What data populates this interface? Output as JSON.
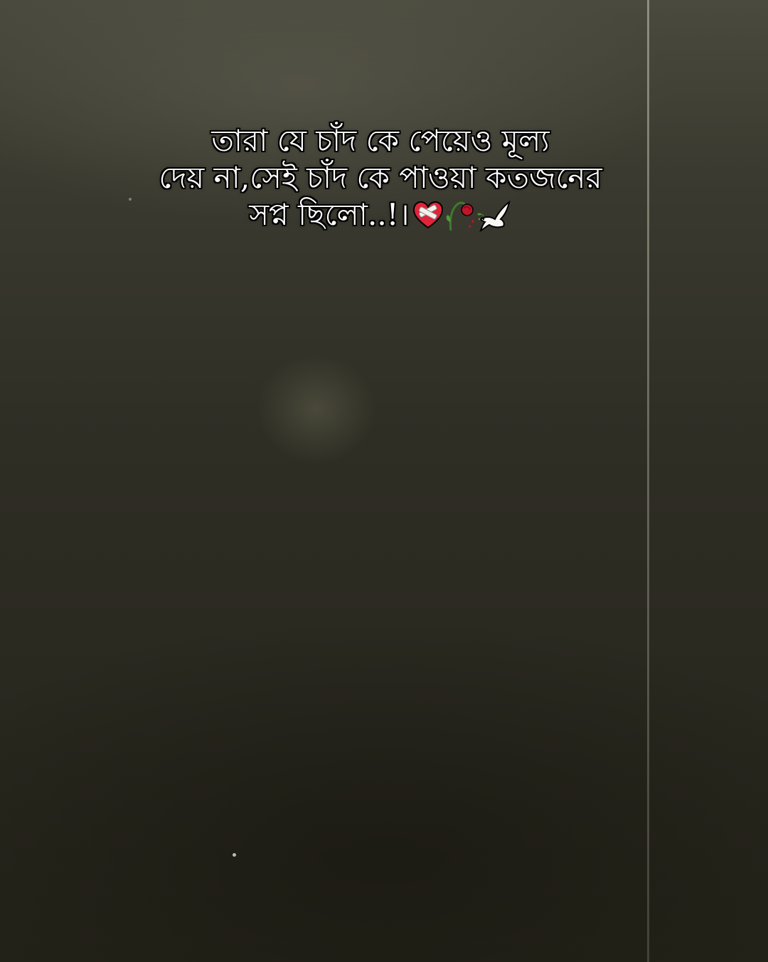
{
  "caption": {
    "line1": "তারা যে চাঁদ কে পেয়েও মূল্য",
    "line2": "দেয় না,সেই চাঁদ কে পাওয়া কতজনের",
    "line3": "সপ্ন ছিলো..!।"
  },
  "emojis": [
    "mending-heart-icon",
    "wilted-rose-icon",
    "dove-icon"
  ],
  "colors": {
    "background": "#2a2920",
    "text": "#ffffff",
    "text_outline": "#000000",
    "light_line": "#c8c6b4"
  }
}
